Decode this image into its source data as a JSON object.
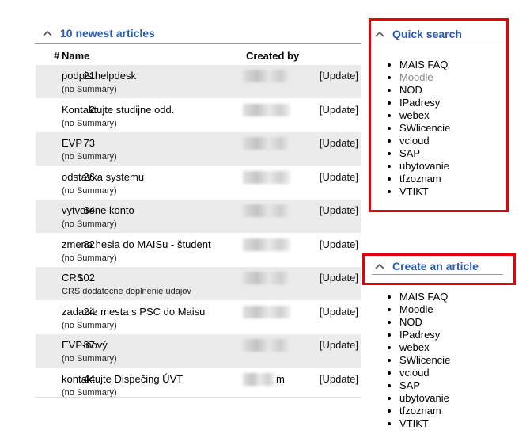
{
  "articles_panel": {
    "title": "10 newest articles",
    "columns": {
      "num": "#",
      "name": "Name",
      "created_by": "Created by"
    },
    "rows": [
      {
        "num": "21",
        "name": "podpis helpdesk",
        "summary": "(no Summary)",
        "update": "[Update]"
      },
      {
        "num": "2",
        "name": "Kontaktujte studijne odd.",
        "summary": "(no Summary)",
        "update": "[Update]"
      },
      {
        "num": "73",
        "name": "EVP",
        "summary": "(no Summary)",
        "update": "[Update]"
      },
      {
        "num": "26",
        "name": "odstavka systemu",
        "summary": "(no Summary)",
        "update": "[Update]"
      },
      {
        "num": "64",
        "name": "vytvorene konto",
        "summary": "(no Summary)",
        "update": "[Update]"
      },
      {
        "num": "82",
        "name": "zmena hesla do MAISu - študent",
        "summary": "(no Summary)",
        "update": "[Update]"
      },
      {
        "num": "102",
        "name": "CRS",
        "summary": "CRS dodatocne doplnenie udajov",
        "update": "[Update]"
      },
      {
        "num": "24",
        "name": "zadanie mesta s PSC do Maisu",
        "summary": "(no Summary)",
        "update": "[Update]"
      },
      {
        "num": "87",
        "name": "EVP-nový",
        "summary": "(no Summary)",
        "update": "[Update]"
      },
      {
        "num": "44",
        "name": "kontaktujte Dispečing ÚVT",
        "summary": "(no Summary)",
        "update": "[Update]",
        "creator_suffix": "m"
      }
    ]
  },
  "quick_search": {
    "title": "Quick search",
    "items": [
      "MAIS FAQ",
      "Moodle",
      "NOD",
      "IPadresy",
      "webex",
      "SWlicencie",
      "vcloud",
      "SAP",
      "ubytovanie",
      "tfzoznam",
      "VTIKT"
    ]
  },
  "create_article": {
    "title": "Create an article",
    "items": [
      "MAIS FAQ",
      "Moodle",
      "NOD",
      "IPadresy",
      "webex",
      "SWlicencie",
      "vcloud",
      "SAP",
      "ubytovanie",
      "tfzoznam",
      "VTIKT"
    ]
  },
  "colors": {
    "link_title": "#2a5db0",
    "highlight_box": "#e8000b",
    "row_shade": "#ebebeb",
    "visited_link": "#8a8a8a"
  },
  "icons": {
    "collapse": "chevron-up-icon"
  }
}
